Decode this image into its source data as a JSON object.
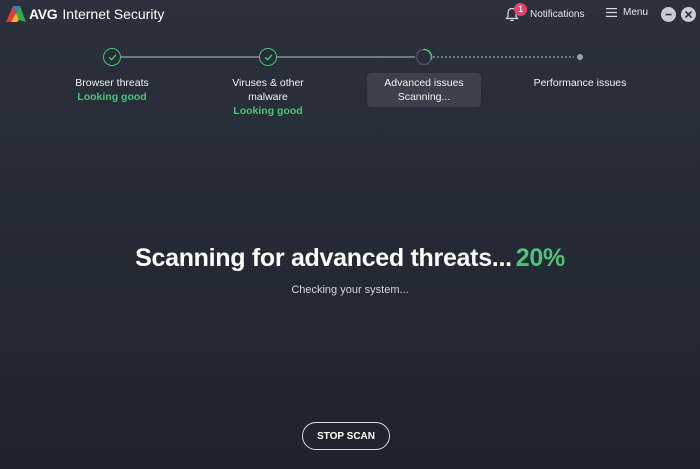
{
  "app": {
    "brand": "AVG",
    "product": "Internet Security"
  },
  "header": {
    "notifications_label": "Notifications",
    "notifications_count": "1",
    "menu_label": "Menu"
  },
  "steps": [
    {
      "name": "Browser threats",
      "status": "Looking good",
      "state": "done"
    },
    {
      "name": "Viruses & other malware",
      "status": "Looking good",
      "state": "done"
    },
    {
      "name": "Advanced issues",
      "status": "Scanning...",
      "state": "active"
    },
    {
      "name": "Performance issues",
      "status": "",
      "state": "pending"
    }
  ],
  "scan": {
    "headline": "Scanning for advanced threats...",
    "percent": "20%",
    "progress_fraction": 0.2,
    "subtext": "Checking your system...",
    "stop_label": "STOP SCAN"
  },
  "colors": {
    "accent_green": "#4fc178",
    "badge_red": "#e8416b",
    "background": "#262d37"
  },
  "icons": [
    "avg-logo-icon",
    "bell-icon",
    "hamburger-icon",
    "minimize-icon",
    "close-icon",
    "check-icon",
    "spinner-icon"
  ]
}
